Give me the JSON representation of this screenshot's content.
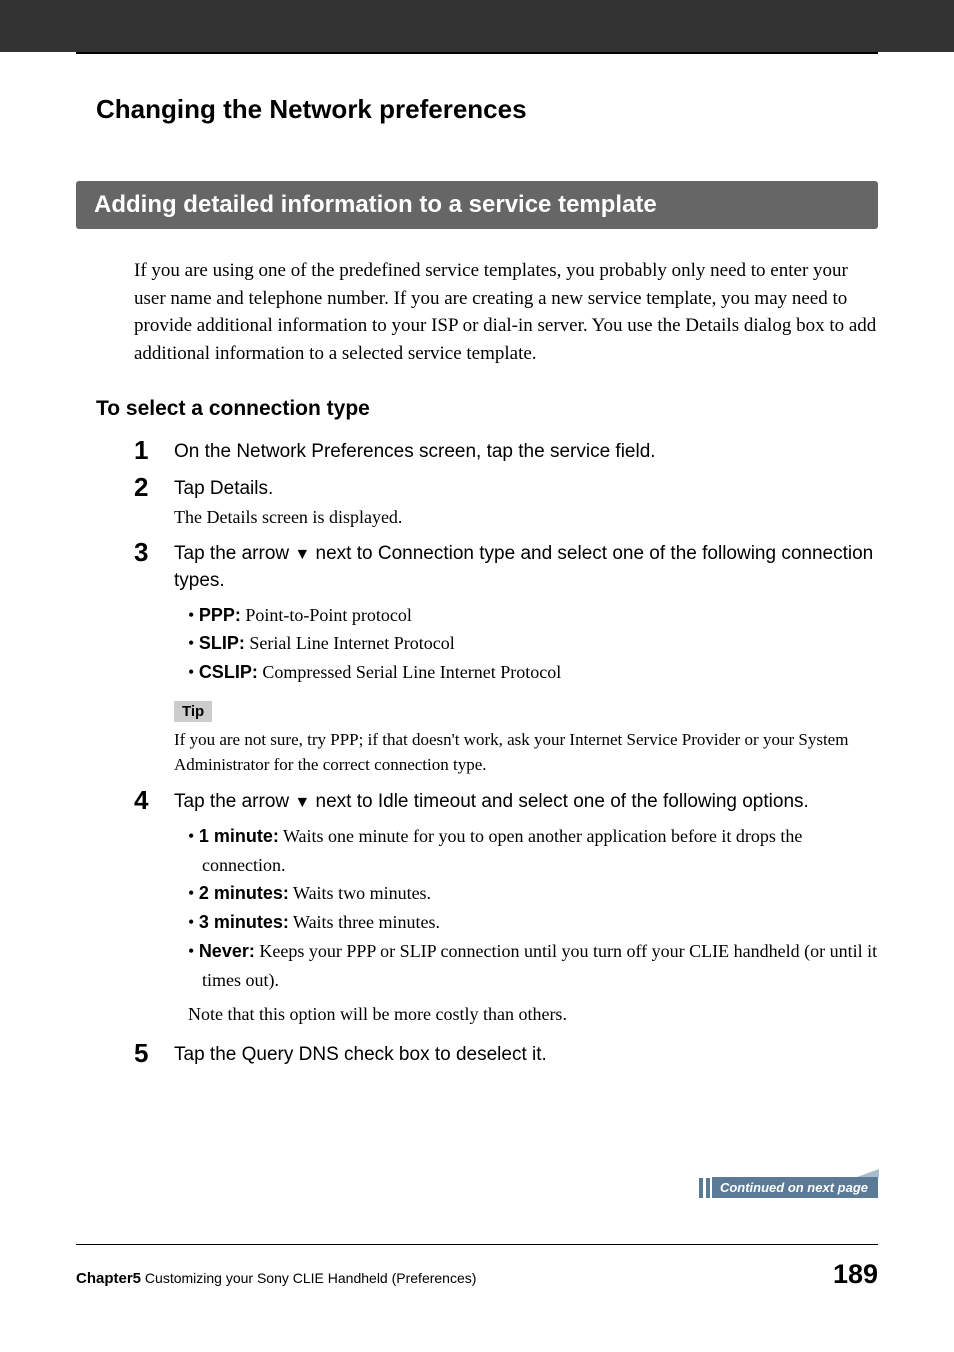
{
  "page_title": "Changing the Network preferences",
  "section_heading": "Adding detailed information to a service template",
  "intro": "If you are using one of the predefined service templates, you probably only need to enter your user name and telephone number. If you are creating a new service template, you may need to provide additional information to your ISP or dial-in server. You use the Details dialog box to add additional information to a selected service template.",
  "sub_heading": "To select a connection type",
  "steps": {
    "s1": {
      "num": "1",
      "instruction": "On the Network Preferences screen, tap the service field."
    },
    "s2": {
      "num": "2",
      "instruction": "Tap Details.",
      "detail": "The Details screen is displayed."
    },
    "s3": {
      "num": "3",
      "instruction_pre": "Tap the arrow ",
      "instruction_post": " next to Connection type and select one of the following connection types.",
      "bullets": [
        {
          "label": "PPP:",
          "desc": " Point-to-Point protocol"
        },
        {
          "label": "SLIP:",
          "desc": " Serial Line Internet Protocol"
        },
        {
          "label": "CSLIP:",
          "desc": " Compressed Serial Line Internet Protocol"
        }
      ],
      "tip_label": "Tip",
      "tip_text": "If you are not sure, try PPP; if that doesn't work, ask your Internet Service Provider or your System Administrator for the correct connection type."
    },
    "s4": {
      "num": "4",
      "instruction_pre": "Tap the arrow ",
      "instruction_post": " next to Idle timeout and select one of the following options.",
      "bullets": [
        {
          "label": "1 minute:",
          "desc": " Waits one minute for you to open another application before it drops the connection."
        },
        {
          "label": "2 minutes:",
          "desc": " Waits two minutes."
        },
        {
          "label": "3 minutes:",
          "desc": " Waits three minutes."
        },
        {
          "label": "Never:",
          "desc": " Keeps your PPP or SLIP connection until you turn off your CLIE handheld (or until it times out)."
        }
      ],
      "note": "Note that this option will be more costly than others."
    },
    "s5": {
      "num": "5",
      "instruction": "Tap the Query DNS check box to deselect it."
    }
  },
  "arrow_glyph": "▼",
  "continued": "Continued on next page",
  "footer": {
    "chapter": "Chapter5",
    "subtitle": "  Customizing your Sony CLIE Handheld (Preferences)",
    "page": "189"
  }
}
